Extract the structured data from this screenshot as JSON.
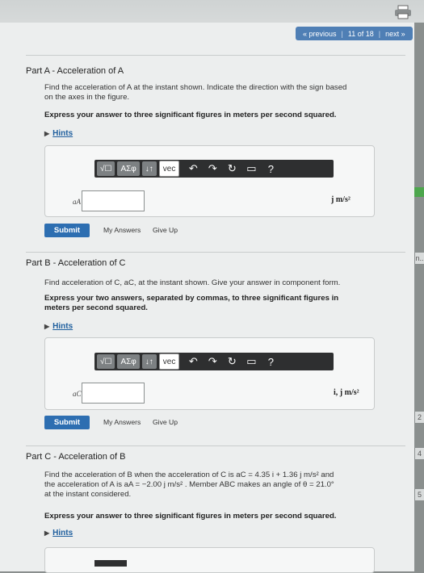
{
  "nav": {
    "previous": "« previous",
    "position": "11 of 18",
    "next": "next »"
  },
  "toolbar": {
    "sqrt": "√☐",
    "greek": "ΑΣφ",
    "arrows": "↓↑",
    "vec": "vec",
    "help": "?"
  },
  "hints_label": "Hints",
  "submit_label": "Submit",
  "my_answers_label": "My Answers",
  "give_up_label": "Give Up",
  "partA": {
    "title": "Part A - Acceleration of A",
    "desc_line1": "Find the acceleration of A at the instant shown. Indicate the direction with the sign based",
    "desc_line2": "on the axes in the figure.",
    "instruction": "Express your answer to three significant figures in meters per second squared.",
    "var_label": "aA =",
    "unit": "j m/s²"
  },
  "partB": {
    "title": "Part B - Acceleration of C",
    "desc": "Find acceleration of C, aC, at the instant shown. Give your answer in component form.",
    "instruction_line1": "Express your two answers, separated by commas, to three significant figures in",
    "instruction_line2": "meters per second squared.",
    "var_label": "aC =",
    "unit": "i, j m/s²"
  },
  "partC": {
    "title": "Part C - Acceleration of B",
    "desc_line1": "Find the acceleration of B when the acceleration of C is aC = 4.35 i + 1.36 j m/s² and",
    "desc_line2": "the acceleration of A is aA = −2.00 j m/s² . Member ABC makes an angle of θ = 21.0°",
    "desc_line3": "at the instant considered.",
    "instruction": "Express your answer to three significant figures in meters per second squared."
  },
  "side_tabs": [
    "n..",
    "2",
    "4",
    "5"
  ],
  "colors": {
    "accent": "#2d6eb1",
    "toolbar": "#2e2f30",
    "link": "#1f5f9e"
  }
}
